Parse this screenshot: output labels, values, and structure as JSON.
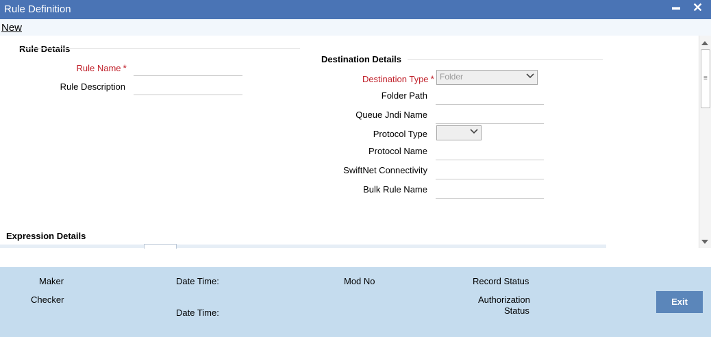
{
  "window": {
    "title": "Rule Definition",
    "minimize": "▬",
    "close": "✕"
  },
  "menu": {
    "new": "New"
  },
  "rule_details": {
    "heading": "Rule Details",
    "rule_name_label": "Rule Name",
    "rule_name_value": "",
    "rule_description_label": "Rule Description",
    "rule_description_value": ""
  },
  "destination_details": {
    "heading": "Destination Details",
    "destination_type_label": "Destination Type",
    "destination_type_value": "Folder",
    "folder_path_label": "Folder Path",
    "queue_jndi_label": "Queue Jndi Name",
    "protocol_type_label": "Protocol Type",
    "protocol_type_value": "",
    "protocol_name_label": "Protocol Name",
    "swiftnet_label": "SwiftNet Connectivity",
    "bulk_rule_label": "Bulk Rule Name"
  },
  "expression_details": {
    "heading": "Expression Details"
  },
  "required_mark": "*",
  "footer": {
    "maker": "Maker",
    "checker": "Checker",
    "date_time_1": "Date Time:",
    "date_time_2": "Date Time:",
    "mod_no": "Mod No",
    "record_status": "Record Status",
    "authorization": "Authorization",
    "status": "Status",
    "exit": "Exit"
  },
  "colors": {
    "titlebar": "#4a74b5",
    "footer": "#c5dcee",
    "required": "#c0202a",
    "exit_button": "#5b86ba"
  }
}
